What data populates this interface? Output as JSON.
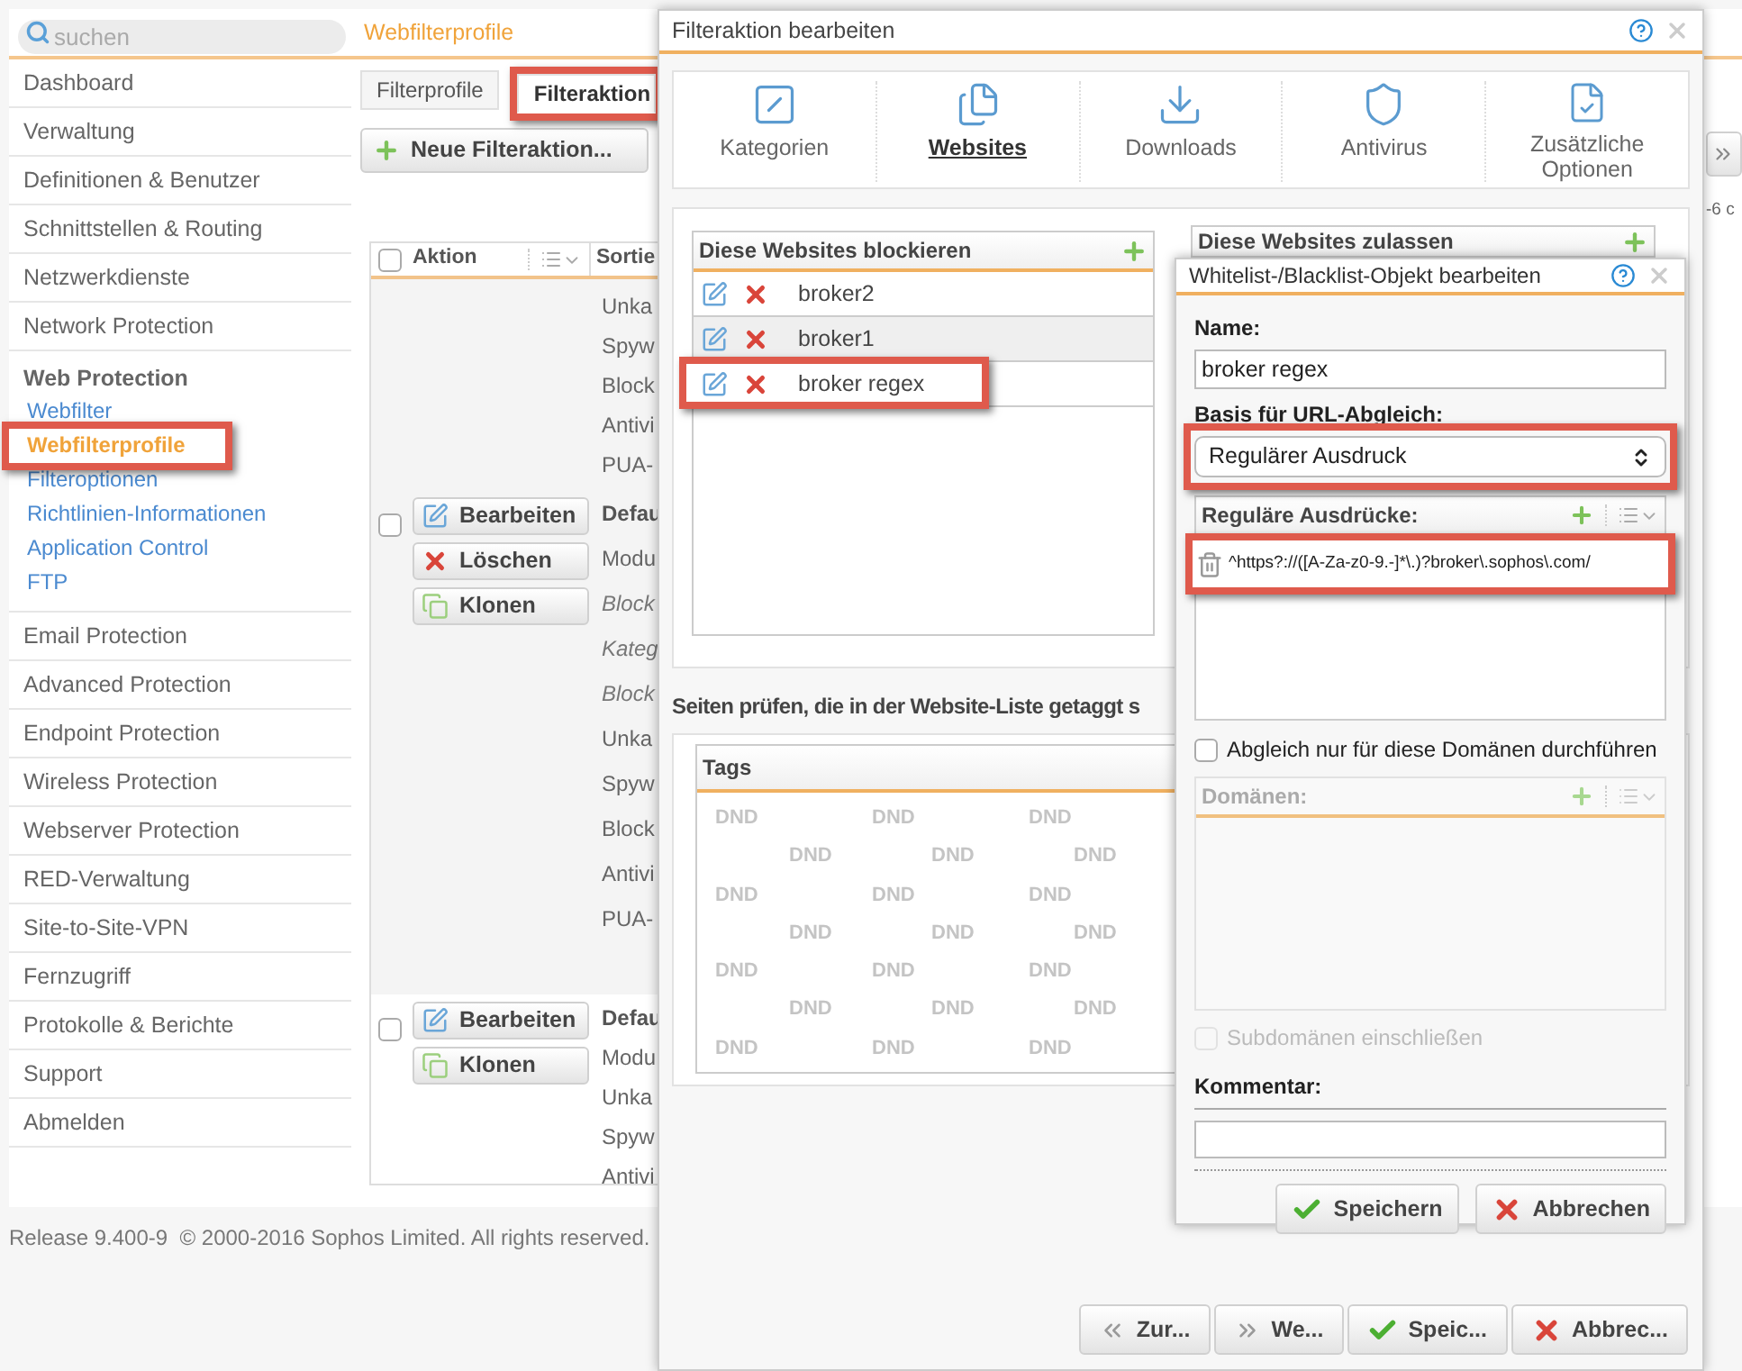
{
  "search": {
    "placeholder": "suchen"
  },
  "page_title": "Webfilterprofile",
  "sidebar": {
    "items": [
      {
        "label": "Dashboard"
      },
      {
        "label": "Verwaltung"
      },
      {
        "label": "Definitionen & Benutzer"
      },
      {
        "label": "Schnittstellen & Routing"
      },
      {
        "label": "Netzwerkdienste"
      },
      {
        "label": "Network Protection"
      },
      {
        "label": "Web Protection",
        "children": [
          {
            "label": "Webfilter",
            "selected": false,
            "highlighted": false
          },
          {
            "label": "Webfilterprofile",
            "selected": true,
            "highlighted": true
          },
          {
            "label": "Filteroptionen",
            "selected": false,
            "highlighted": false
          },
          {
            "label": "Richtlinien-Informationen",
            "selected": false,
            "highlighted": false
          },
          {
            "label": "Application Control",
            "selected": false,
            "highlighted": false
          },
          {
            "label": "FTP",
            "selected": false,
            "highlighted": false
          }
        ]
      },
      {
        "label": "Email Protection"
      },
      {
        "label": "Advanced Protection"
      },
      {
        "label": "Endpoint Protection"
      },
      {
        "label": "Wireless Protection"
      },
      {
        "label": "Webserver Protection"
      },
      {
        "label": "RED-Verwaltung"
      },
      {
        "label": "Site-to-Site-VPN"
      },
      {
        "label": "Fernzugriff"
      },
      {
        "label": "Protokolle & Berichte"
      },
      {
        "label": "Support"
      },
      {
        "label": "Abmelden"
      }
    ]
  },
  "tabs": [
    {
      "label": "Filterprofile",
      "selected": false,
      "highlighted": false
    },
    {
      "label": "Filteraktion",
      "selected": true,
      "highlighted": true
    }
  ],
  "new_button": "Neue Filteraktion...",
  "page_info": "-6 c",
  "table": {
    "columns": [
      "Aktion",
      "Sortie"
    ],
    "select_all_checked": false,
    "rows": [
      {
        "actions": [],
        "lines": [
          {
            "text": "Unka",
            "kind": "normal"
          },
          {
            "text": "Spyw",
            "kind": "normal"
          },
          {
            "text": "Block",
            "kind": "normal"
          },
          {
            "text": "Antivi",
            "kind": "normal"
          },
          {
            "text": "PUA-",
            "kind": "normal"
          }
        ]
      },
      {
        "checked": false,
        "actions": [
          {
            "kind": "edit",
            "label": "Bearbeiten"
          },
          {
            "kind": "delete",
            "label": "Löschen"
          },
          {
            "kind": "clone",
            "label": "Klonen"
          }
        ],
        "lines": [
          {
            "text": "Defau",
            "kind": "bold"
          },
          {
            "text": "Modu",
            "kind": "normal"
          },
          {
            "text": "Block",
            "kind": "italic"
          },
          {
            "text": "Kateg",
            "kind": "italic"
          },
          {
            "text": "Block",
            "kind": "italic"
          },
          {
            "text": "Unka",
            "kind": "normal"
          },
          {
            "text": "Spyw",
            "kind": "normal"
          },
          {
            "text": "Block",
            "kind": "normal"
          },
          {
            "text": "Antivi",
            "kind": "normal"
          },
          {
            "text": "PUA-",
            "kind": "normal"
          }
        ]
      },
      {
        "checked": false,
        "actions": [
          {
            "kind": "edit",
            "label": "Bearbeiten"
          },
          {
            "kind": "clone",
            "label": "Klonen"
          }
        ],
        "lines": [
          {
            "text": "Defau",
            "kind": "bold"
          },
          {
            "text": "Modu",
            "kind": "normal"
          },
          {
            "text": "Unka",
            "kind": "normal"
          },
          {
            "text": "Spyw",
            "kind": "normal"
          },
          {
            "text": "Antivi",
            "kind": "normal"
          }
        ]
      }
    ]
  },
  "footer": "Release 9.400-9  © 2000-2016 Sophos Limited. All rights reserved.",
  "dialog": {
    "title": "Filteraktion bearbeiten",
    "tabs": [
      {
        "kind": "categories",
        "label": "Kategorien",
        "selected": false
      },
      {
        "kind": "websites",
        "label": "Websites",
        "selected": true
      },
      {
        "kind": "downloads",
        "label": "Downloads",
        "selected": false
      },
      {
        "kind": "antivirus",
        "label": "Antivirus",
        "selected": false
      },
      {
        "kind": "options",
        "label": "Zusätzliche Optionen",
        "selected": false
      }
    ],
    "block_list": {
      "title": "Diese Websites blockieren",
      "items": [
        {
          "name": "broker2",
          "selected": false,
          "highlighted": false
        },
        {
          "name": "broker1",
          "selected": true,
          "highlighted": false
        },
        {
          "name": "broker regex",
          "selected": false,
          "highlighted": true
        }
      ]
    },
    "allow_list": {
      "title": "Diese Websites zulassen"
    },
    "tag_heading": "Seiten prüfen, die in der Website-Liste getaggt s",
    "tags": {
      "title": "Tags",
      "watermark": [
        "DND",
        "DND",
        "DND",
        "DND",
        "DND",
        "DND",
        "DND",
        "DND",
        "DND",
        "DND",
        "DND",
        "DND",
        "DND",
        "DND",
        "DND",
        "DND",
        "DND",
        "DND",
        "DND",
        "DND",
        "DND"
      ]
    },
    "buttons": [
      {
        "kind": "back",
        "label": "Zur..."
      },
      {
        "kind": "next",
        "label": "We..."
      },
      {
        "kind": "save",
        "label": "Speic..."
      },
      {
        "kind": "cancel",
        "label": "Abbrec..."
      }
    ]
  },
  "subdialog": {
    "title": "Whitelist-/Blacklist-Objekt bearbeiten",
    "name_label": "Name:",
    "name_value": "broker regex",
    "basis_label": "Basis für URL-Abgleich:",
    "basis_value": "Regulärer Ausdruck",
    "basis_highlighted": true,
    "regex_list": {
      "title": "Reguläre Ausdrücke:",
      "items": [
        {
          "text": "^https?://([A-Za-z0-9.-]*\\.)?broker\\.sophos\\.com/",
          "highlighted": true
        }
      ]
    },
    "domain_only": {
      "label": "Abgleich nur für diese Domänen durchführen",
      "checked": false
    },
    "domains": {
      "title": "Domänen:",
      "disabled": true
    },
    "subdomains": {
      "label": "Subdomänen einschließen",
      "checked": false,
      "disabled": true
    },
    "comment_label": "Kommentar:",
    "buttons": [
      {
        "kind": "save",
        "label": "Speichern"
      },
      {
        "kind": "cancel",
        "label": "Abbrechen"
      }
    ]
  }
}
